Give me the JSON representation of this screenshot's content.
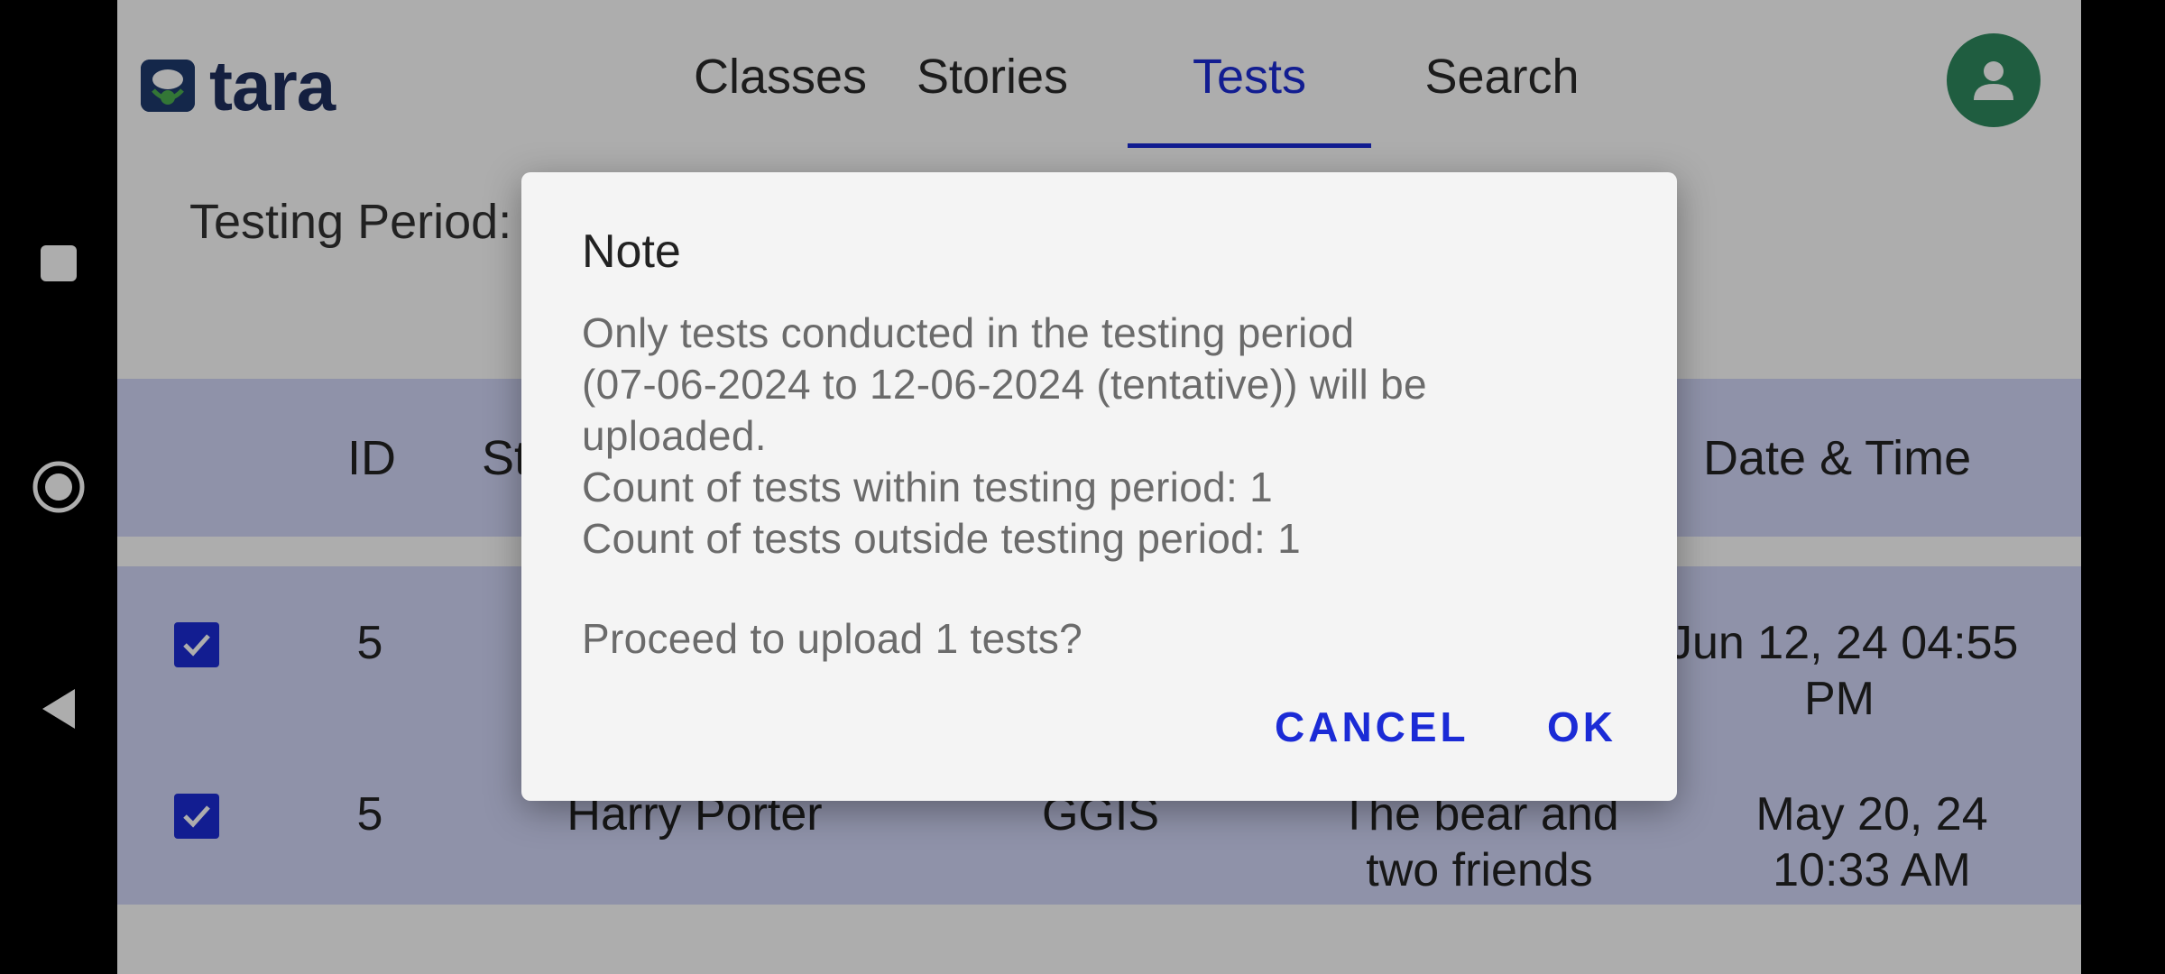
{
  "app": {
    "logo_text": "tara",
    "tabs": [
      {
        "label": "Classes"
      },
      {
        "label": "Stories"
      },
      {
        "label": "Tests"
      },
      {
        "label": "Search"
      }
    ],
    "active_tab": "Tests",
    "accent_color": "#1b2bd6",
    "avatar_color": "#2f8a5f",
    "testing_period_text": "Testing Period: (07-06-2024 to 12-06-2024 (tentative))"
  },
  "table": {
    "headers": {
      "id": "ID",
      "student": "Student",
      "date_time": "Date & Time"
    },
    "rows": [
      {
        "checked": true,
        "id": "5",
        "student": "",
        "school": "",
        "story": "",
        "date_line1": "Jun 12, 24 04:55",
        "date_line2": "PM"
      },
      {
        "checked": true,
        "id": "5",
        "student": "Harry Porter",
        "school": "GGIS",
        "story_line1": "The bear and",
        "story_line2": "two friends",
        "date_line1": "May 20, 24",
        "date_line2": "10:33 AM"
      }
    ]
  },
  "dialog": {
    "title": "Note",
    "body": "Only tests conducted in the testing period\n(07-06-2024 to 12-06-2024 (tentative)) will be\nuploaded.\nCount of tests within testing period: 1\nCount of tests outside testing period: 1",
    "question": "Proceed to upload 1 tests?",
    "cancel_label": "CANCEL",
    "ok_label": "OK"
  },
  "system_nav": {
    "icons": [
      "square-recents-icon",
      "circle-home-icon",
      "triangle-back-icon"
    ]
  }
}
